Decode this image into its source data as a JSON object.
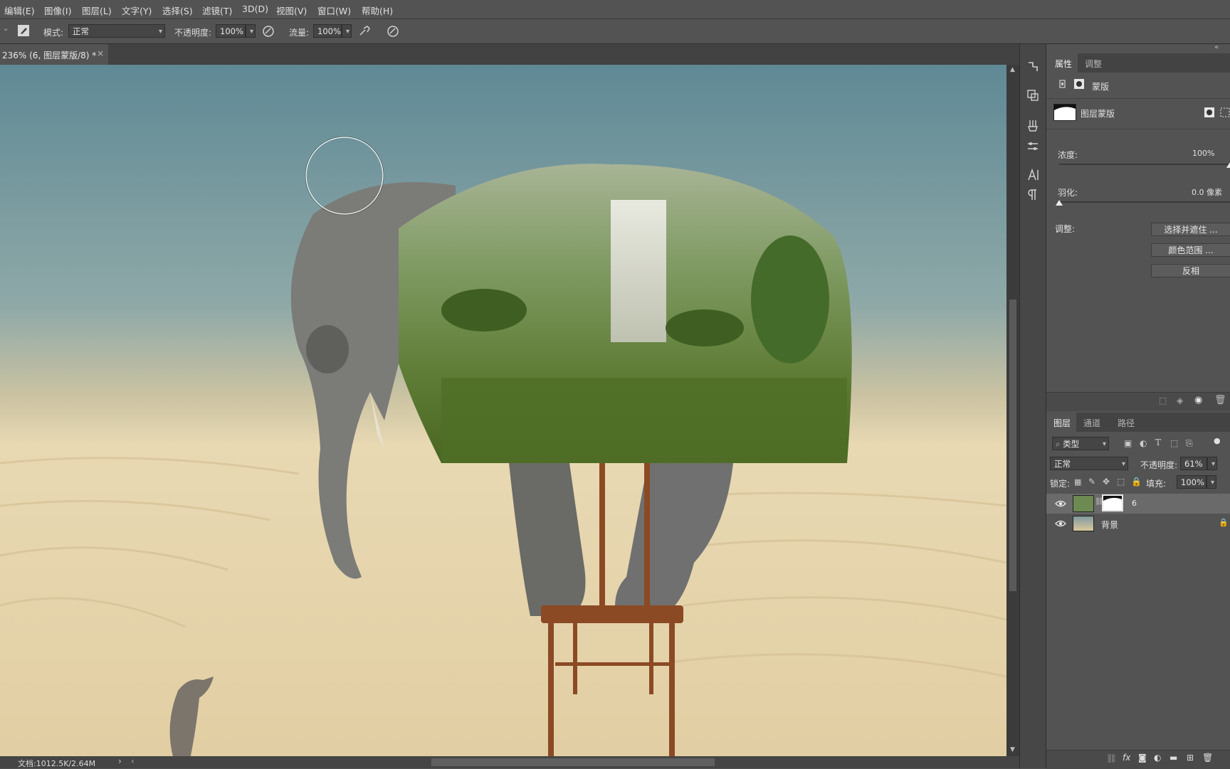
{
  "menu": [
    "编辑(E)",
    "图像(I)",
    "图层(L)",
    "文字(Y)",
    "选择(S)",
    "滤镜(T)",
    "3D(D)",
    "视图(V)",
    "窗口(W)",
    "帮助(H)"
  ],
  "options": {
    "mode_label": "模式:",
    "mode_value": "正常",
    "opacity_label": "不透明度:",
    "opacity_value": "100%",
    "flow_label": "流量:",
    "flow_value": "100%"
  },
  "document": {
    "tab_title": "236% (6, 图层蒙版/8) *",
    "close": "×",
    "status": "文档:1012.5K/2.64M",
    "status_arrow": "›",
    "scroll_left": "‹"
  },
  "panel_collapse": "«",
  "properties": {
    "tabs": [
      "属性",
      "调整"
    ],
    "type_label": "蒙版",
    "mask_label": "图层蒙版",
    "density_label": "浓度:",
    "density_value": "100%",
    "density_level": 1.0,
    "feather_label": "羽化:",
    "feather_value": "0.0 像素",
    "feather_level": 0.0,
    "adjust_label": "调整:",
    "buttons": [
      "选择并遮住 ...",
      "颜色范围 ...",
      "反相"
    ]
  },
  "layers": {
    "tabs": [
      "图层",
      "通道",
      "路径"
    ],
    "filter_label": "类型",
    "blend_mode": "正常",
    "opacity_label": "不透明度:",
    "opacity_value": "61%",
    "lock_label": "锁定:",
    "fill_label": "填充:",
    "fill_value": "100%",
    "items": [
      {
        "name": "6",
        "visible": true,
        "selected": true
      },
      {
        "name": "背景",
        "visible": true,
        "locked": true
      }
    ]
  },
  "colors": {
    "ui_bg": "#535353",
    "panel_dark": "#434343",
    "selected_layer": "#6a6a6a"
  }
}
